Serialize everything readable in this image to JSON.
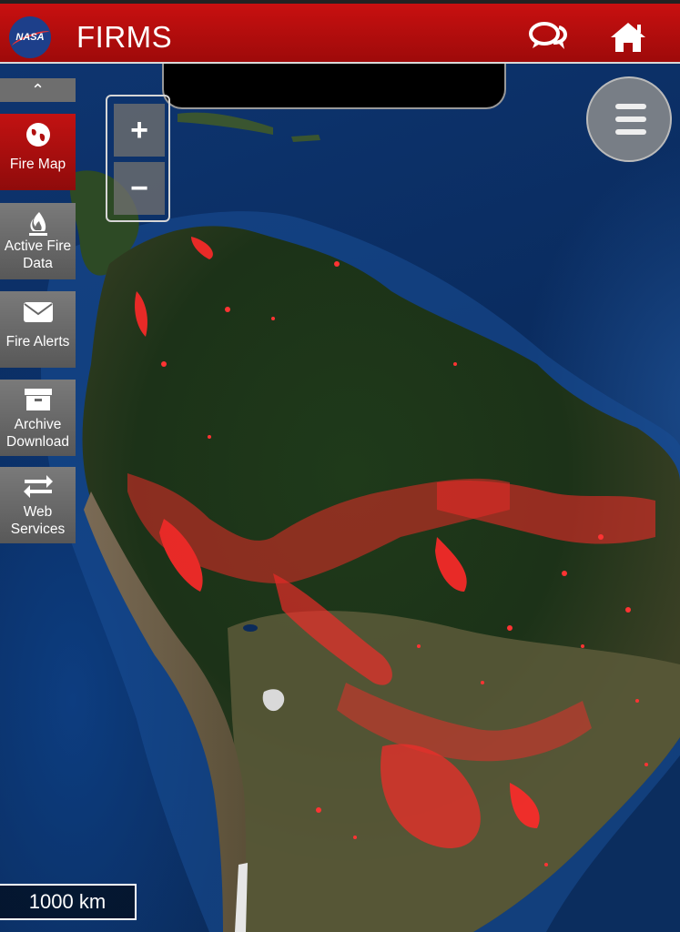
{
  "header": {
    "logo_text": "NASA",
    "title": "FIRMS",
    "chat_icon": "chat-bubbles-icon",
    "home_icon": "home-icon"
  },
  "sidebar": {
    "collapse_icon": "double-chevron-up-icon",
    "items": [
      {
        "label": "Fire Map",
        "icon": "globe-icon",
        "active": true
      },
      {
        "label": "Active Fire Data",
        "icon": "flame-icon",
        "active": false
      },
      {
        "label": "Fire Alerts",
        "icon": "envelope-icon",
        "active": false
      },
      {
        "label": "Archive Download",
        "icon": "archive-box-icon",
        "active": false
      },
      {
        "label": "Web Services",
        "icon": "swap-arrows-icon",
        "active": false
      }
    ]
  },
  "map_controls": {
    "zoom_in": "+",
    "zoom_out": "−",
    "menu_icon": "hamburger-menu-icon"
  },
  "scale_bar": {
    "label": "1000 km"
  },
  "colors": {
    "brand_red": "#b50e0e",
    "fire_red": "#ff2a2a",
    "button_gray": "#6e6e6e"
  }
}
